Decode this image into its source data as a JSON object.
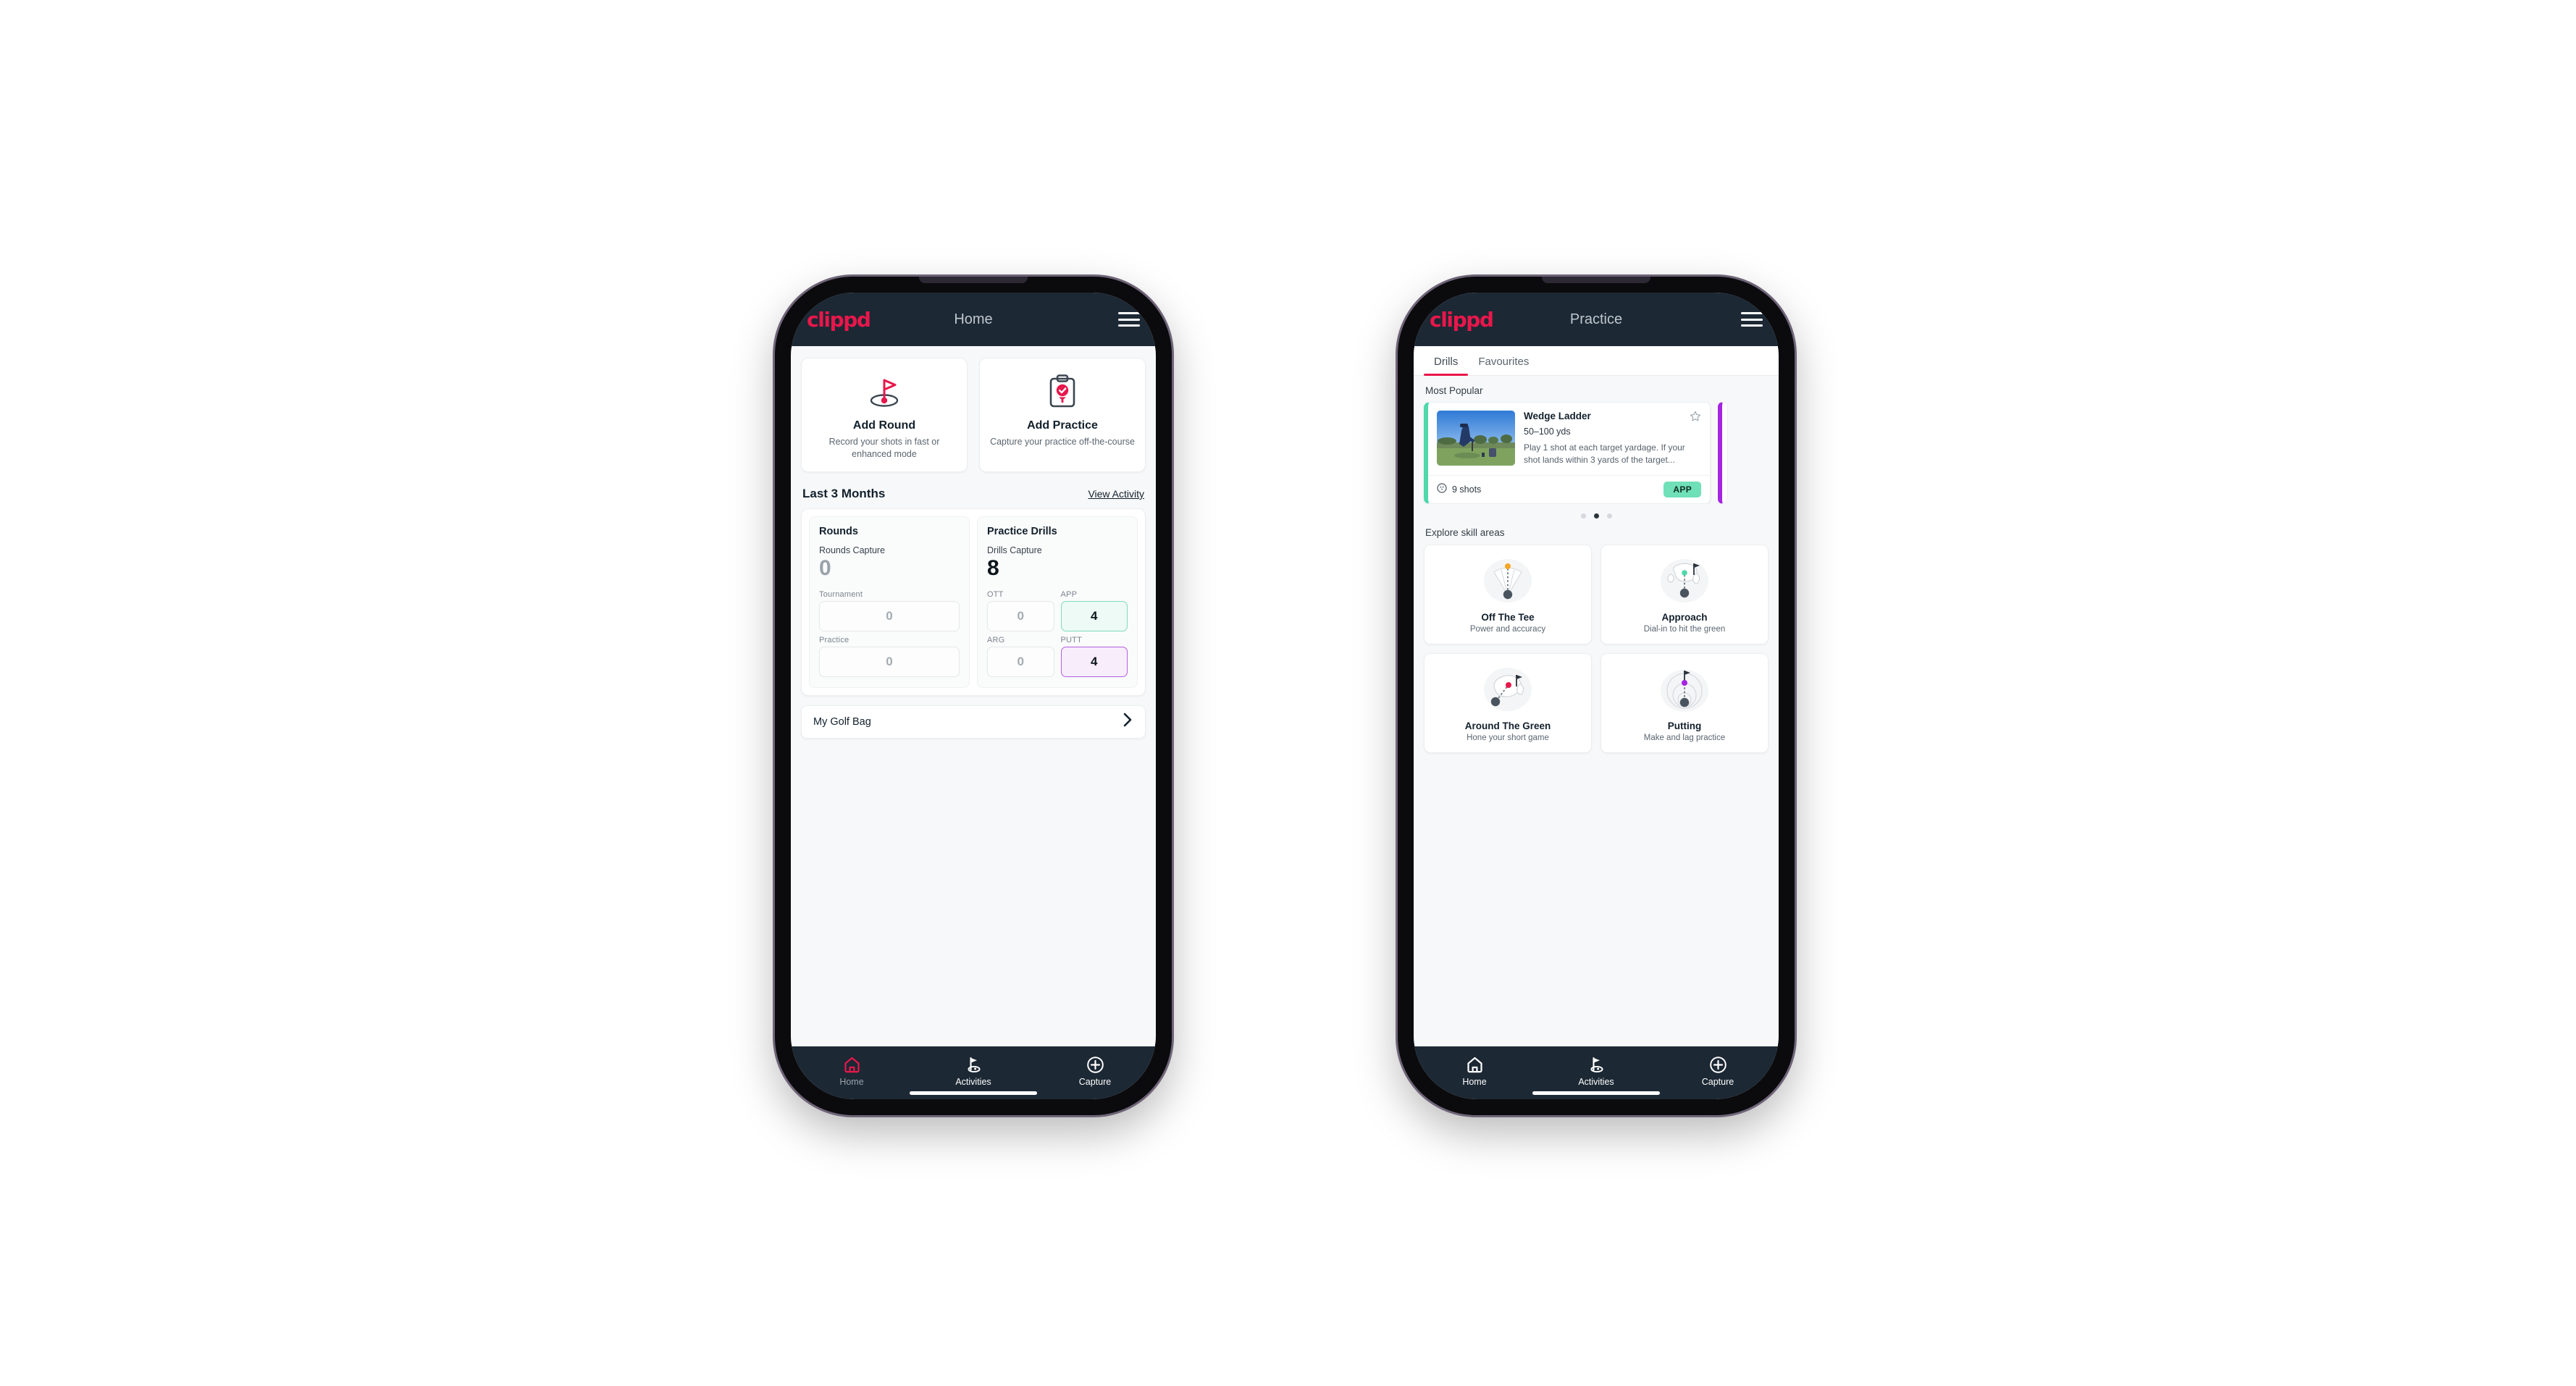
{
  "brand": {
    "logo_text": "clippd",
    "accent_pink": "#e8174b",
    "dark_navy": "#1c2834",
    "teal": "#6fe0b8",
    "purple": "#a524e0",
    "amber": "#f5a623"
  },
  "home_phone": {
    "appbar": {
      "logo": "clippd",
      "title": "Home",
      "menu_icon": "hamburger-menu-icon"
    },
    "action_cards": [
      {
        "icon": "golf-flag-hole-icon",
        "title": "Add Round",
        "subtitle": "Record your shots in fast or enhanced mode"
      },
      {
        "icon": "clipboard-check-tee-icon",
        "title": "Add Practice",
        "subtitle": "Capture your practice off-the-course"
      }
    ],
    "section": {
      "title": "Last 3 Months",
      "link": "View Activity"
    },
    "stats": {
      "rounds": {
        "heading": "Rounds",
        "capture_label": "Rounds Capture",
        "capture_value": "0",
        "metrics": [
          {
            "label": "Tournament",
            "value": "0",
            "state": "plain"
          },
          {
            "label": "Practice",
            "value": "0",
            "state": "plain"
          }
        ]
      },
      "drills": {
        "heading": "Practice Drills",
        "capture_label": "Drills Capture",
        "capture_value": "8",
        "metrics": [
          {
            "label": "OTT",
            "value": "0",
            "state": "plain"
          },
          {
            "label": "APP",
            "value": "4",
            "state": "teal"
          },
          {
            "label": "ARG",
            "value": "0",
            "state": "plain"
          },
          {
            "label": "PUTT",
            "value": "4",
            "state": "purple"
          }
        ]
      }
    },
    "golf_bag": {
      "label": "My Golf Bag",
      "chevron_icon": "chevron-right-icon"
    },
    "bottom_nav": {
      "items": [
        {
          "label": "Home",
          "icon": "home-icon",
          "active": true
        },
        {
          "label": "Activities",
          "icon": "golf-flag-icon",
          "active": false
        },
        {
          "label": "Capture",
          "icon": "plus-circle-icon",
          "active": false
        }
      ]
    }
  },
  "practice_phone": {
    "appbar": {
      "logo": "clippd",
      "title": "Practice",
      "menu_icon": "hamburger-menu-icon"
    },
    "tabs": [
      {
        "label": "Drills",
        "active": true
      },
      {
        "label": "Favourites",
        "active": false
      }
    ],
    "most_popular_label": "Most Popular",
    "drill_card": {
      "title": "Wedge Ladder",
      "yardage": "50–100 yds",
      "description": "Play 1 shot at each target yardage. If your shot lands within 3 yards of the target...",
      "shots": "9 shots",
      "shots_icon": "golf-ball-icon",
      "chip": "APP",
      "star_icon": "star-outline-icon",
      "accent": "#4fd8ab",
      "thumbnail_alt": "golfer-chipping-photo"
    },
    "peek_card_accent": "#a524e0",
    "carousel_dots": {
      "count": 3,
      "active_index": 1
    },
    "skills_label": "Explore skill areas",
    "skills": [
      {
        "title": "Off The Tee",
        "subtitle": "Power and accuracy",
        "icon": "tee-shot-fan-icon",
        "dot_color": "#f5a623"
      },
      {
        "title": "Approach",
        "subtitle": "Dial-in to hit the green",
        "icon": "green-approach-icon",
        "dot_color": "#4fd8ab"
      },
      {
        "title": "Around The Green",
        "subtitle": "Hone your short game",
        "icon": "chip-shot-icon",
        "dot_color": "#e8174b"
      },
      {
        "title": "Putting",
        "subtitle": "Make and lag practice",
        "icon": "putting-rings-icon",
        "dot_color": "#a524e0"
      }
    ],
    "bottom_nav": {
      "items": [
        {
          "label": "Home",
          "icon": "home-icon",
          "active": false
        },
        {
          "label": "Activities",
          "icon": "golf-flag-icon",
          "active": true
        },
        {
          "label": "Capture",
          "icon": "plus-circle-icon",
          "active": false
        }
      ]
    }
  }
}
